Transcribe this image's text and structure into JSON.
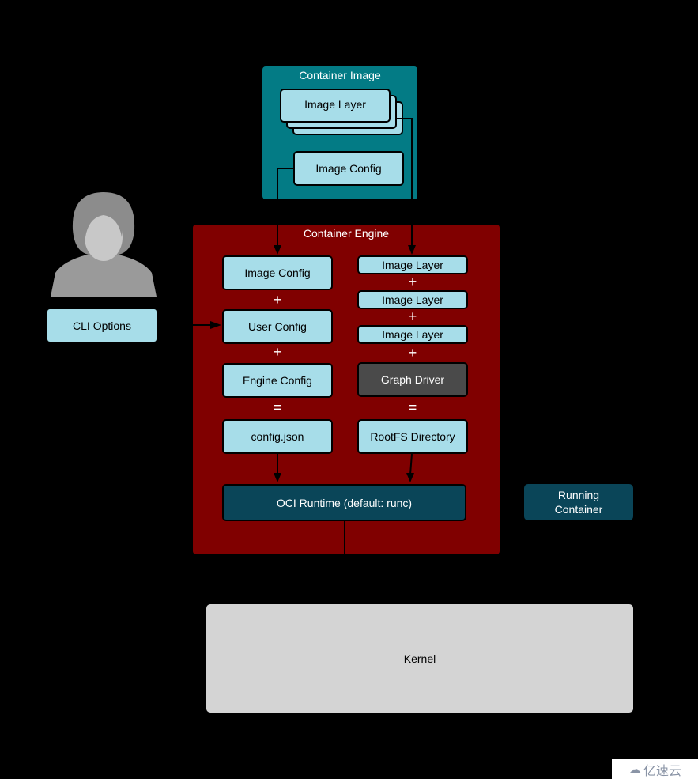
{
  "container_image": {
    "title": "Container Image",
    "layer_label": "Image Layer",
    "config_label": "Image Config",
    "color": "#037b85"
  },
  "engine": {
    "title": "Container Engine",
    "color": "#800000",
    "left": {
      "image_config": "Image Config",
      "user_config": "User Config",
      "engine_config": "Engine Config",
      "config_json": "config.json"
    },
    "right": {
      "layers": [
        "Image Layer",
        "Image Layer",
        "Image Layer"
      ],
      "graph_driver": "Graph Driver",
      "rootfs": "RootFS Directory"
    },
    "plus": "+",
    "equals": "=",
    "runtime": "OCI Runtime (default: runc)"
  },
  "cli_options": "CLI Options",
  "running_container": "Running Container",
  "kernel": "Kernel",
  "watermark": "亿速云"
}
